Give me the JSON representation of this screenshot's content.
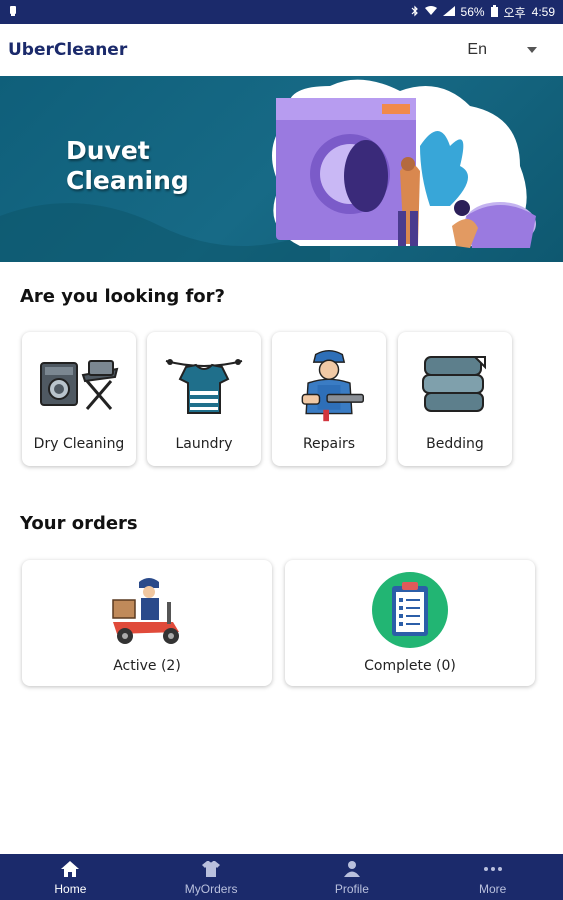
{
  "status_bar": {
    "battery": "56%",
    "period": "오후",
    "time": "4:59"
  },
  "app_bar": {
    "title": "UberCleaner",
    "language": "En"
  },
  "banner": {
    "title": "Duvet Cleaning"
  },
  "categories_section": {
    "title": "Are you looking for?",
    "items": [
      {
        "label": "Dry Cleaning",
        "icon": "dry-cleaning-icon"
      },
      {
        "label": "Laundry",
        "icon": "laundry-icon"
      },
      {
        "label": "Repairs",
        "icon": "repairs-icon"
      },
      {
        "label": "Bedding",
        "icon": "bedding-icon"
      }
    ]
  },
  "orders_section": {
    "title": "Your orders",
    "items": [
      {
        "label": "Active (2)",
        "icon": "delivery-scooter-icon"
      },
      {
        "label": "Complete (0)",
        "icon": "clipboard-checklist-icon"
      }
    ]
  },
  "bottom_nav": {
    "items": [
      {
        "label": "Home",
        "icon": "home-icon",
        "active": true
      },
      {
        "label": "MyOrders",
        "icon": "shirt-icon",
        "active": false
      },
      {
        "label": "Profile",
        "icon": "person-icon",
        "active": false
      },
      {
        "label": "More",
        "icon": "more-dots-icon",
        "active": false
      }
    ]
  },
  "colors": {
    "primary": "#1b2a6b",
    "banner": "#176a86",
    "accent_purple": "#8a63d2"
  }
}
